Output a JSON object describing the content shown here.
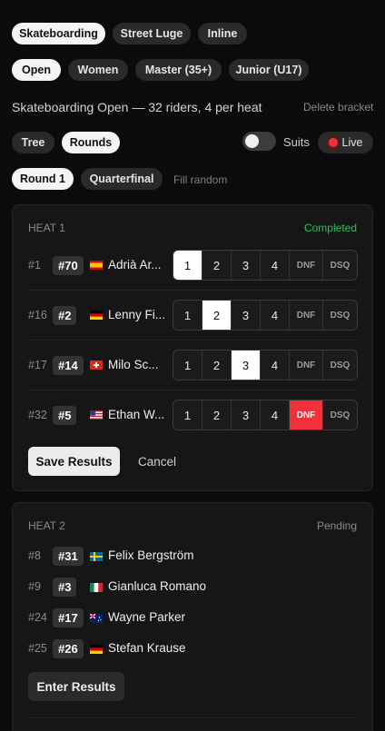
{
  "disciplines": [
    "Skateboarding",
    "Street Luge",
    "Inline"
  ],
  "categories": [
    "Open",
    "Women",
    "Master (35+)",
    "Junior (U17)"
  ],
  "summary": "Skateboarding Open — 32 riders, 4 per heat",
  "delete_label": "Delete bracket",
  "views": [
    "Tree",
    "Rounds"
  ],
  "suits_label": "Suits",
  "live_label": "Live",
  "rounds": [
    "Round 1",
    "Quarterfinal"
  ],
  "fill_random_label": "Fill random",
  "heat1": {
    "title": "HEAT 1",
    "status": "Completed",
    "status_color": "#22c55e",
    "options": [
      "1",
      "2",
      "3",
      "4",
      "DNF",
      "DSQ"
    ],
    "riders": [
      {
        "seed": "#1",
        "bib": "#70",
        "flag": "es",
        "name": "Adrià Ar...",
        "result": 0
      },
      {
        "seed": "#16",
        "bib": "#2",
        "flag": "de",
        "name": "Lenny Fi...",
        "result": 1
      },
      {
        "seed": "#17",
        "bib": "#14",
        "flag": "ch",
        "name": "Milo Sc...",
        "result": 2
      },
      {
        "seed": "#32",
        "bib": "#5",
        "flag": "us",
        "name": "Ethan W...",
        "result": 4
      }
    ],
    "save_label": "Save Results",
    "cancel_label": "Cancel"
  },
  "heat2": {
    "title": "HEAT 2",
    "status": "Pending",
    "riders": [
      {
        "seed": "#8",
        "bib": "#31",
        "flag": "se",
        "name": "Felix Bergström"
      },
      {
        "seed": "#9",
        "bib": "#3",
        "flag": "it",
        "name": "Gianluca Romano"
      },
      {
        "seed": "#24",
        "bib": "#17",
        "flag": "au",
        "name": "Wayne Parker"
      },
      {
        "seed": "#25",
        "bib": "#26",
        "flag": "de",
        "name": "Stefan Krause"
      }
    ],
    "enter_label": "Enter Results"
  }
}
